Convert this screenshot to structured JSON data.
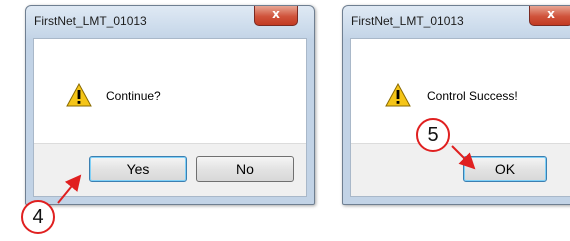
{
  "dialog_left": {
    "title": "FirstNet_LMT_01013",
    "close_label": "x",
    "icon": "warning-icon",
    "message": "Continue?",
    "buttons": {
      "yes": "Yes",
      "no": "No"
    }
  },
  "dialog_right": {
    "title": "FirstNet_LMT_01013",
    "close_label": "x",
    "icon": "warning-icon",
    "message": "Control Success!",
    "buttons": {
      "ok": "OK"
    }
  },
  "annotations": {
    "step_4": "4",
    "step_5": "5",
    "arrow_color": "#e02020"
  }
}
